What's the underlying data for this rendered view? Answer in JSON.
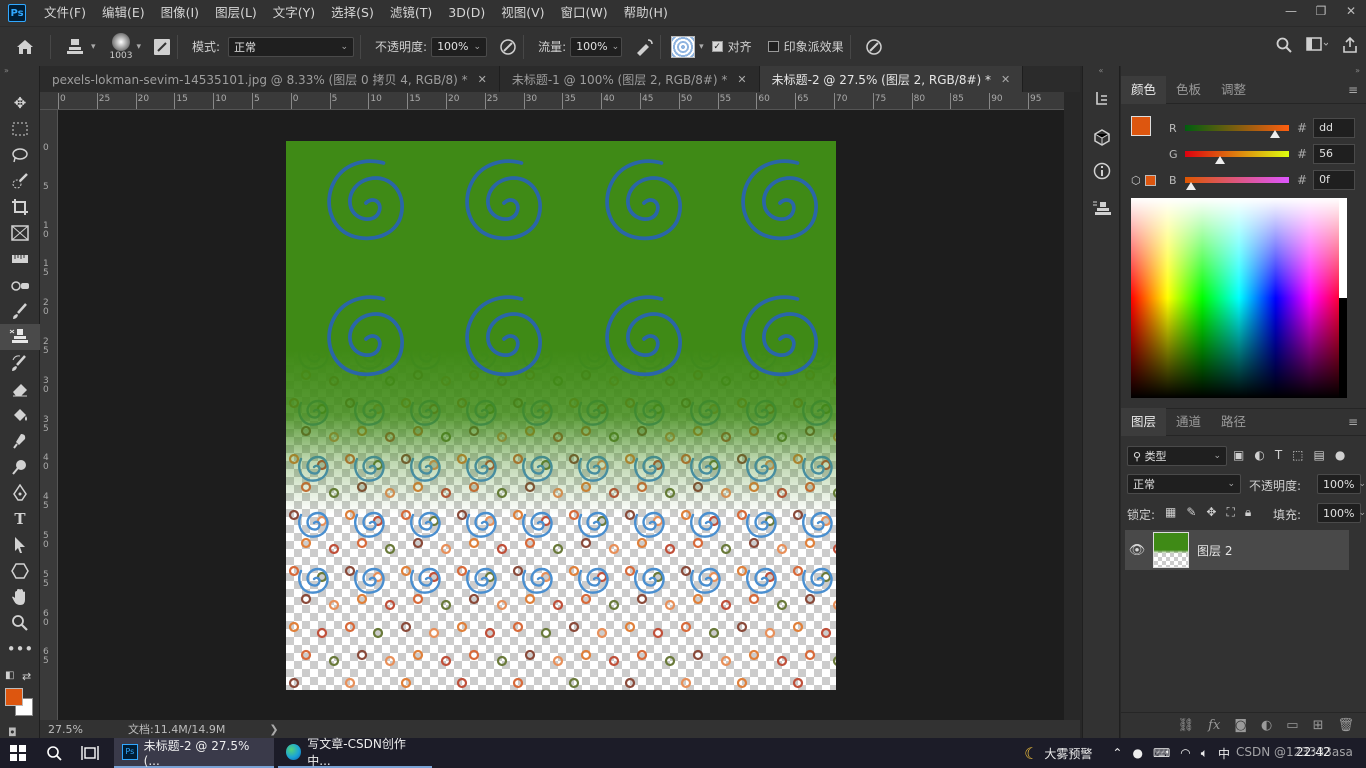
{
  "app": {
    "logo": "Ps",
    "menu": [
      "文件(F)",
      "编辑(E)",
      "图像(I)",
      "图层(L)",
      "文字(Y)",
      "选择(S)",
      "滤镜(T)",
      "3D(D)",
      "视图(V)",
      "窗口(W)",
      "帮助(H)"
    ],
    "window_controls": [
      "—",
      "❐",
      "✕"
    ]
  },
  "options": {
    "brush_size": "1003",
    "mode_label": "模式:",
    "mode_value": "正常",
    "opacity_label": "不透明度:",
    "opacity_value": "100%",
    "flow_label": "流量:",
    "flow_value": "100%",
    "align_label": "对齐",
    "align_checked": true,
    "impressionist_label": "印象派效果",
    "impressionist_checked": false
  },
  "tabs": [
    {
      "label": "pexels-lokman-sevim-14535101.jpg @ 8.33% (图层 0 拷贝 4, RGB/8) *",
      "active": false
    },
    {
      "label": "未标题-1 @ 100% (图层 2, RGB/8#) *",
      "active": false
    },
    {
      "label": "未标题-2 @ 27.5% (图层 2, RGB/8#) *",
      "active": true
    }
  ],
  "ruler": {
    "h_ticks": [
      "0",
      "25",
      "20",
      "15",
      "10",
      "5",
      "0",
      "5",
      "10",
      "15",
      "20",
      "25",
      "30",
      "35",
      "40",
      "45",
      "50",
      "55",
      "60",
      "65",
      "70",
      "75",
      "80",
      "85",
      "90",
      "95"
    ],
    "v_ticks": [
      "0",
      "5",
      "1 0",
      "1 5",
      "2 0",
      "2 5",
      "3 0",
      "3 5",
      "4 0",
      "4 5",
      "5 0",
      "5 5",
      "6 0",
      "6 5"
    ]
  },
  "status": {
    "zoom": "27.5%",
    "doc_info": "文档:11.4M/14.9M",
    "arrow": "❯"
  },
  "color_panel": {
    "tabs": [
      "颜色",
      "色板",
      "调整"
    ],
    "active_tab": 0,
    "r_label": "R",
    "r_hex": "dd",
    "r_value": 0.867,
    "g_label": "G",
    "g_hex": "56",
    "g_value": 0.337,
    "b_label": "B",
    "b_hex": "0f",
    "b_value": 0.059,
    "foreground": "#dd560f",
    "background": "#ffffff"
  },
  "layers_panel": {
    "tabs": [
      "图层",
      "通道",
      "路径"
    ],
    "active_tab": 0,
    "filter_label": "类型",
    "blend_mode": "正常",
    "opacity_label": "不透明度:",
    "opacity_value": "100%",
    "lock_label": "锁定:",
    "fill_label": "填充:",
    "fill_value": "100%",
    "layers": [
      {
        "name": "图层 2",
        "visible": true
      }
    ]
  },
  "taskbar": {
    "apps": [
      {
        "label": "未标题-2 @ 27.5% (...",
        "active": true
      },
      {
        "label": "写文章-CSDN创作中...",
        "active": false
      }
    ],
    "weather": "大雾预警",
    "tray_text": "中",
    "clock": "22:42",
    "watermark": "CSDN @123333asa"
  },
  "colors": {
    "accent_ps": "#31a8ff",
    "canvas_green": "#3f8a16",
    "spiral_blue": "#2f6fb5"
  }
}
